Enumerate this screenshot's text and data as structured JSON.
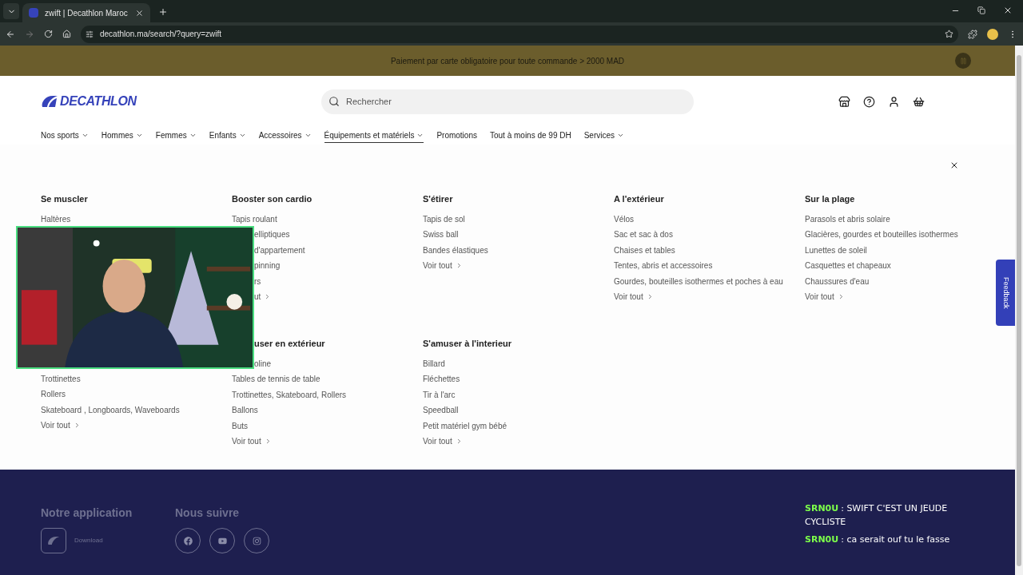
{
  "browser": {
    "tab": {
      "title": "zwift | Decathlon Maroc",
      "selected": true
    },
    "url": "decathlon.ma/search/?query=zwift"
  },
  "banner": {
    "text": "Paiement par carte obligatoire pour toute commande > 2000 MAD"
  },
  "header": {
    "logo": "DECATHLON",
    "search": {
      "placeholder": "Rechercher"
    }
  },
  "nav": [
    {
      "label": "Nos sports",
      "has_menu": true,
      "selected": false
    },
    {
      "label": "Hommes",
      "has_menu": true,
      "selected": false
    },
    {
      "label": "Femmes",
      "has_menu": true,
      "selected": false
    },
    {
      "label": "Enfants",
      "has_menu": true,
      "selected": false
    },
    {
      "label": "Accessoires",
      "has_menu": true,
      "selected": false
    },
    {
      "label": "Équipements et matériels",
      "has_menu": true,
      "selected": true
    },
    {
      "label": "Promotions",
      "has_menu": false,
      "selected": false
    },
    {
      "label": "Tout à moins de 99 DH",
      "has_menu": false,
      "selected": false
    },
    {
      "label": "Services",
      "has_menu": true,
      "selected": false
    }
  ],
  "menu_rows": [
    {
      "columns": [
        {
          "heading": "Se muscler",
          "items": [
            {
              "kind": "link",
              "text": "Haltères"
            }
          ]
        },
        {
          "heading": "Booster son cardio",
          "items": [
            {
              "kind": "link",
              "text": "Tapis roulant"
            },
            {
              "kind": "partial",
              "text": "elliptiques"
            },
            {
              "kind": "partial",
              "text": "d'appartement"
            },
            {
              "kind": "partial",
              "text": "pinning"
            },
            {
              "kind": "partial",
              "text": "rs"
            },
            {
              "kind": "partial-more",
              "text": "ut"
            }
          ]
        },
        {
          "heading": "S'étirer",
          "items": [
            {
              "kind": "link",
              "text": "Tapis de sol"
            },
            {
              "kind": "link",
              "text": "Swiss ball"
            },
            {
              "kind": "link",
              "text": "Bandes élastiques"
            },
            {
              "kind": "more",
              "text": "Voir tout"
            }
          ]
        },
        {
          "heading": "A l'extérieur",
          "items": [
            {
              "kind": "link",
              "text": "Vélos"
            },
            {
              "kind": "link",
              "text": "Sac et sac à dos"
            },
            {
              "kind": "link",
              "text": "Chaises et tables"
            },
            {
              "kind": "link",
              "text": "Tentes, abris et accessoires"
            },
            {
              "kind": "link",
              "text": "Gourdes, bouteilles isothermes et poches à eau"
            },
            {
              "kind": "more",
              "text": "Voir tout"
            }
          ]
        },
        {
          "heading": "Sur la plage",
          "items": [
            {
              "kind": "link",
              "text": "Parasols et abris solaire"
            },
            {
              "kind": "link",
              "text": "Glacières, gourdes et bouteilles isothermes"
            },
            {
              "kind": "link",
              "text": "Lunettes de soleil"
            },
            {
              "kind": "link",
              "text": "Casquettes et chapeaux"
            },
            {
              "kind": "link",
              "text": "Chaussures d'eau"
            },
            {
              "kind": "more",
              "text": "Voir tout"
            }
          ]
        }
      ]
    },
    {
      "columns": [
        {
          "items": [
            {
              "kind": "link",
              "text": "Trottinettes"
            },
            {
              "kind": "link",
              "text": "Rollers"
            },
            {
              "kind": "link",
              "text": "Skateboard , Longboards, Waveboards"
            },
            {
              "kind": "more",
              "text": "Voir tout"
            }
          ]
        },
        {
          "heading": "user en extérieur",
          "heading_partial": true,
          "items": [
            {
              "kind": "partial",
              "text": "oline"
            },
            {
              "kind": "link",
              "text": "Tables de tennis de table"
            },
            {
              "kind": "link",
              "text": "Trottinettes, Skateboard, Rollers"
            },
            {
              "kind": "link",
              "text": "Ballons"
            },
            {
              "kind": "link",
              "text": "Buts"
            },
            {
              "kind": "more",
              "text": "Voir tout"
            }
          ]
        },
        {
          "heading": "S'amuser à l'interieur",
          "items": [
            {
              "kind": "link",
              "text": "Billard"
            },
            {
              "kind": "link",
              "text": "Fléchettes"
            },
            {
              "kind": "link",
              "text": "Tir à l'arc"
            },
            {
              "kind": "link",
              "text": "Speedball"
            },
            {
              "kind": "link",
              "text": "Petit matériel gym bébé"
            },
            {
              "kind": "more",
              "text": "Voir tout"
            }
          ]
        }
      ]
    }
  ],
  "feedback": "Feedback",
  "footer": {
    "app_heading": "Notre application",
    "download": "Download",
    "social_heading": "Nous suivre",
    "social": [
      {
        "kind": "facebook"
      },
      {
        "kind": "youtube"
      },
      {
        "kind": "instagram"
      }
    ]
  },
  "chat": [
    {
      "user": "SRN0U",
      "message": ": SWIFT C'EST UN JEUDE CYCLISTE"
    },
    {
      "user": "SRN0U",
      "message": ": ca serait ouf tu le fasse"
    }
  ]
}
